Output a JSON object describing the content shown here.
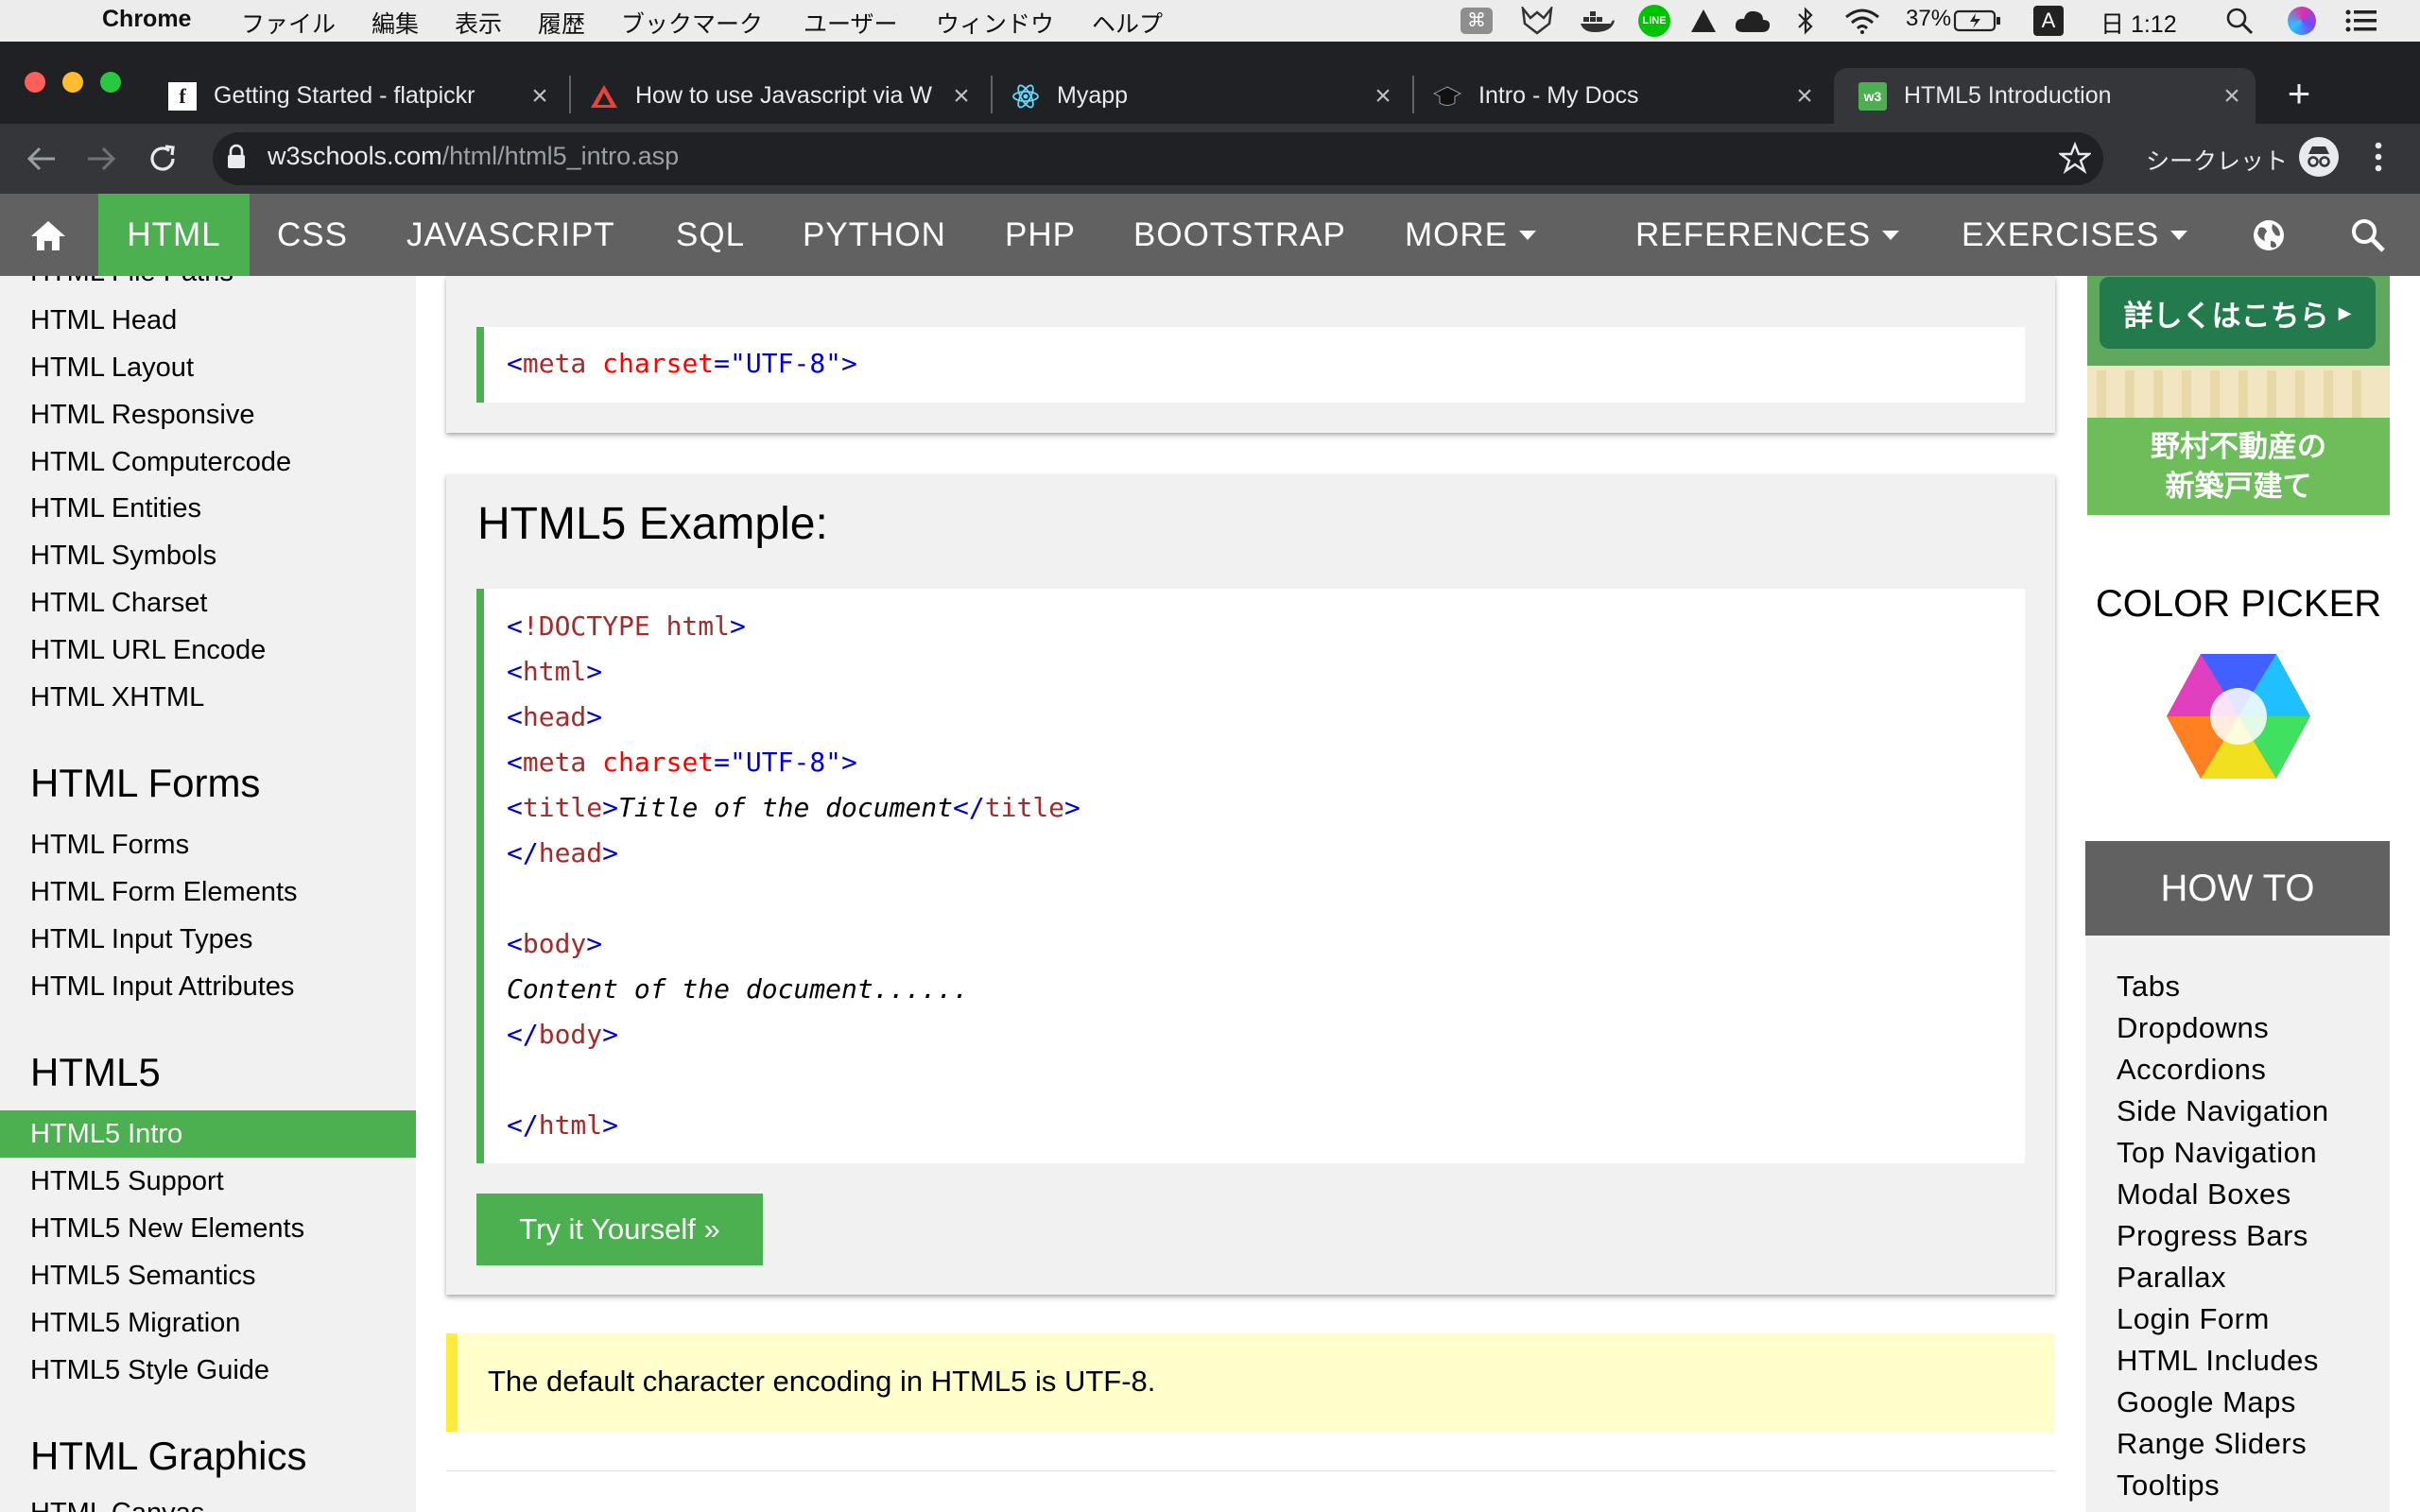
{
  "menubar": {
    "app": "Chrome",
    "items": [
      "ファイル",
      "編集",
      "表示",
      "履歴",
      "ブックマーク",
      "ユーザー",
      "ウィンドウ",
      "ヘルプ"
    ],
    "battery": "37%",
    "clock": "日 1:12"
  },
  "tabs": [
    {
      "title": "Getting Started - flatpickr"
    },
    {
      "title": "How to use Javascript via W"
    },
    {
      "title": "Myapp"
    },
    {
      "title": "Intro - My Docs"
    },
    {
      "title": "HTML5 Introduction"
    }
  ],
  "toolbar": {
    "url_host": "w3schools.com",
    "url_path": "/html/html5_intro.asp",
    "incognito_label": "シークレット"
  },
  "topnav": {
    "items": [
      "HTML",
      "CSS",
      "JAVASCRIPT",
      "SQL",
      "PYTHON",
      "PHP",
      "BOOTSTRAP",
      "MORE",
      "REFERENCES",
      "EXERCISES"
    ],
    "active": "HTML"
  },
  "sidebar": {
    "cut_top": "HTML File Paths",
    "group1": [
      "HTML Head",
      "HTML Layout",
      "HTML Responsive",
      "HTML Computercode",
      "HTML Entities",
      "HTML Symbols",
      "HTML Charset",
      "HTML URL Encode",
      "HTML XHTML"
    ],
    "forms_head": "HTML Forms",
    "forms": [
      "HTML Forms",
      "HTML Form Elements",
      "HTML Input Types",
      "HTML Input Attributes"
    ],
    "html5_head": "HTML5",
    "html5": [
      "HTML5 Intro",
      "HTML5 Support",
      "HTML5 New Elements",
      "HTML5 Semantics",
      "HTML5 Migration",
      "HTML5 Style Guide"
    ],
    "graphics_head": "HTML Graphics",
    "cut_bottom": "HTML Canvas"
  },
  "main": {
    "meta_line": {
      "open": "<",
      "tag": "meta",
      "attr": "charset",
      "eq": "=",
      "value": "\"UTF-8\"",
      "close": ">"
    },
    "example_title": "HTML5 Example:",
    "code": {
      "l1": {
        "open": "<",
        "tag": "!DOCTYPE html",
        "close": ">"
      },
      "l2": {
        "open": "<",
        "tag": "html",
        "close": ">"
      },
      "l3": {
        "open": "<",
        "tag": "head",
        "close": ">"
      },
      "l4": {
        "open": "<",
        "tag": "meta",
        "attr": "charset",
        "eq": "=",
        "value": "\"UTF-8\"",
        "close": ">"
      },
      "l5": {
        "open": "<",
        "tag": "title",
        "close": ">",
        "text": "Title of the document",
        "open2": "</",
        "tag2": "title",
        "close2": ">"
      },
      "l6": {
        "open": "</",
        "tag": "head",
        "close": ">"
      },
      "l7": {
        "open": "<",
        "tag": "body",
        "close": ">"
      },
      "l8": {
        "text": "Content of the document......"
      },
      "l9": {
        "open": "</",
        "tag": "body",
        "close": ">"
      },
      "l10": {
        "open": "</",
        "tag": "html",
        "close": ">"
      }
    },
    "try_button": "Try it Yourself »",
    "note": "The default character encoding in HTML5 is UTF-8."
  },
  "right": {
    "ad_button": "詳しくはこちら",
    "ad_line1": "野村不動産の",
    "ad_line2": "新築戸建て",
    "color_picker": "COLOR PICKER",
    "howto_title": "HOW TO",
    "howto": [
      "Tabs",
      "Dropdowns",
      "Accordions",
      "Side Navigation",
      "Top Navigation",
      "Modal Boxes",
      "Progress Bars",
      "Parallax",
      "Login Form",
      "HTML Includes",
      "Google Maps",
      "Range Sliders",
      "Tooltips"
    ]
  },
  "colors": {
    "w3_green": "#4caf50",
    "nav_gray": "#616161",
    "panel_gray": "#f1f1f1",
    "note_yellow": "#ffffcc",
    "chrome_dark": "#202124"
  }
}
